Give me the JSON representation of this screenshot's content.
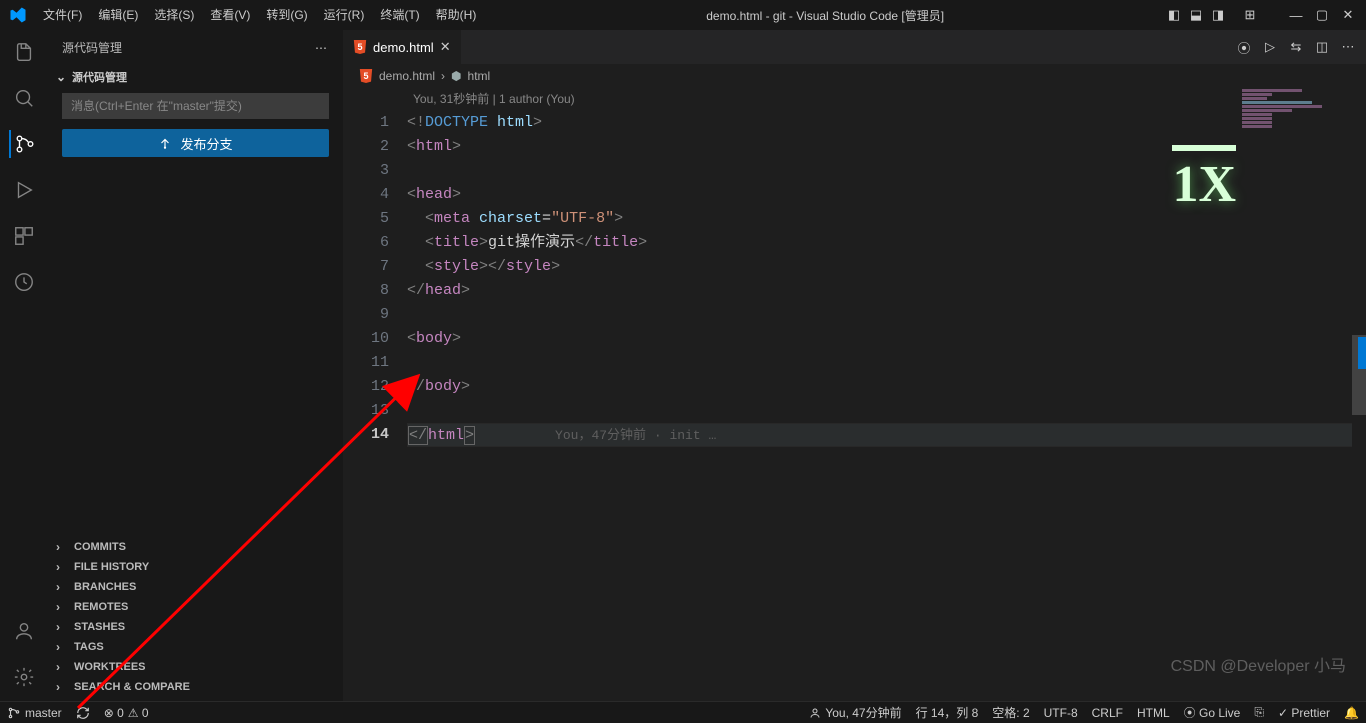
{
  "titlebar": {
    "menus": [
      "文件(F)",
      "编辑(E)",
      "选择(S)",
      "查看(V)",
      "转到(G)",
      "运行(R)",
      "终端(T)",
      "帮助(H)"
    ],
    "title": "demo.html - git - Visual Studio Code [管理员]"
  },
  "sidebar": {
    "title": "源代码管理",
    "section": "源代码管理",
    "commit_placeholder": "消息(Ctrl+Enter 在\"master\"提交)",
    "publish_label": "发布分支",
    "sections": [
      "COMMITS",
      "FILE HISTORY",
      "BRANCHES",
      "REMOTES",
      "STASHES",
      "TAGS",
      "WORKTREES",
      "SEARCH & COMPARE"
    ]
  },
  "tab": {
    "name": "demo.html"
  },
  "breadcrumb": {
    "file": "demo.html",
    "node": "html"
  },
  "codelens": "You, 31秒钟前 | 1 author (You)",
  "code": {
    "l1a": "<!",
    "l1b": "DOCTYPE",
    "l1c": " html",
    "l1d": ">",
    "l2a": "<",
    "l2b": "html",
    "l2c": ">",
    "l4a": "<",
    "l4b": "head",
    "l4c": ">",
    "l5a": "  <",
    "l5b": "meta",
    "l5c": " charset",
    "l5d": "=",
    "l5e": "\"UTF-8\"",
    "l5f": ">",
    "l6a": "  <",
    "l6b": "title",
    "l6c": ">",
    "l6d": "git操作演示",
    "l6e": "</",
    "l6f": "title",
    "l6g": ">",
    "l7a": "  <",
    "l7b": "style",
    "l7c": "></",
    "l7d": "style",
    "l7e": ">",
    "l8a": "</",
    "l8b": "head",
    "l8c": ">",
    "l10a": "<",
    "l10b": "body",
    "l10c": ">",
    "l12a": "</",
    "l12b": "body",
    "l12c": ">",
    "l14a": "</",
    "l14b": "html",
    "l14c": ">",
    "blame14": "You，47分钟前 · init …"
  },
  "line_numbers": [
    "1",
    "2",
    "3",
    "4",
    "5",
    "6",
    "7",
    "8",
    "9",
    "10",
    "11",
    "12",
    "13",
    "14"
  ],
  "watermark": "1X",
  "csdn": "CSDN @Developer 小马",
  "status": {
    "branch": "master",
    "sync": "⟳",
    "errors": "⊗ 0",
    "warnings": "⚠ 0",
    "blame": "You, 47分钟前",
    "pos": "行 14，列 8",
    "spaces": "空格: 2",
    "encoding": "UTF-8",
    "eol": "CRLF",
    "lang": "HTML",
    "golive": "⦿ Go Live",
    "prettier": "✓ Prettier",
    "bell": "🔔"
  }
}
